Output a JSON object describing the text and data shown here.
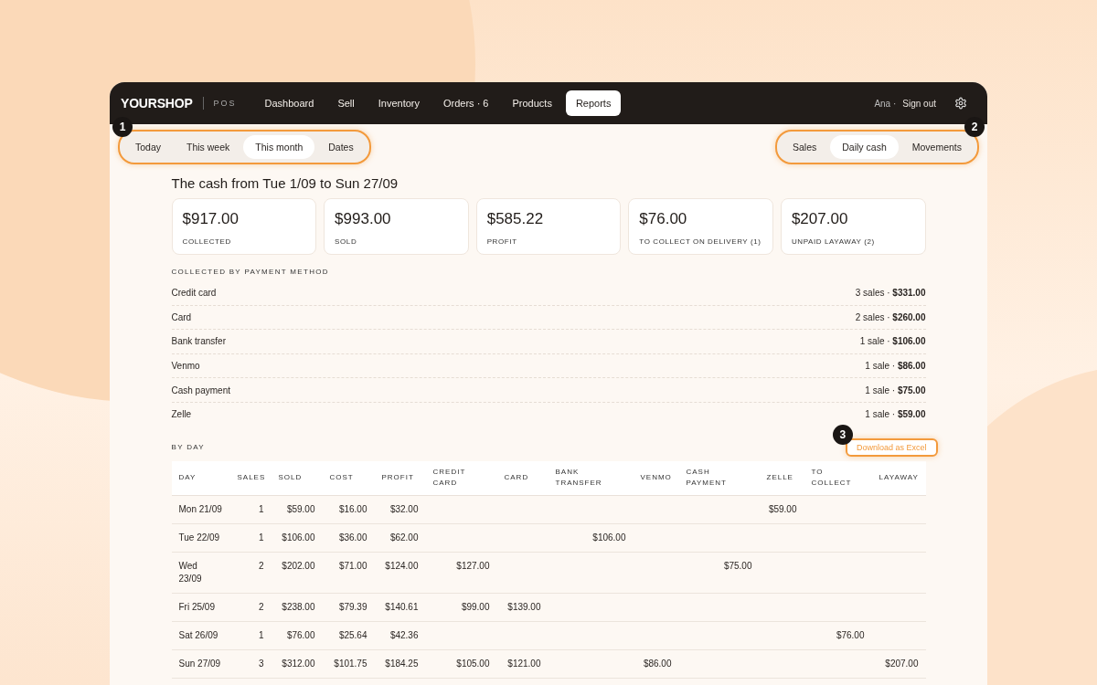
{
  "brand": {
    "name": "YOURSHOP",
    "suffix": "POS"
  },
  "nav": [
    {
      "label": "Dashboard",
      "selected": false
    },
    {
      "label": "Sell",
      "selected": false
    },
    {
      "label": "Inventory",
      "selected": false
    },
    {
      "label": "Orders · 6",
      "selected": false
    },
    {
      "label": "Products",
      "selected": false
    },
    {
      "label": "Reports",
      "selected": true
    }
  ],
  "user": {
    "name": "Ana ·",
    "action": "Sign out"
  },
  "period_tabs": {
    "marker": "1",
    "items": [
      {
        "label": "Today",
        "selected": false
      },
      {
        "label": "This week",
        "selected": false
      },
      {
        "label": "This month",
        "selected": true
      },
      {
        "label": "Dates",
        "selected": false
      }
    ]
  },
  "view_tabs": {
    "marker": "2",
    "items": [
      {
        "label": "Sales",
        "selected": false
      },
      {
        "label": "Daily cash",
        "selected": true
      },
      {
        "label": "Movements",
        "selected": false
      }
    ]
  },
  "title": "The cash from Tue 1/09 to Sun 27/09",
  "stats": [
    {
      "value": "$917.00",
      "label": "COLLECTED"
    },
    {
      "value": "$993.00",
      "label": "SOLD"
    },
    {
      "value": "$585.22",
      "label": "PROFIT"
    },
    {
      "value": "$76.00",
      "label": "TO COLLECT ON DELIVERY (1)"
    },
    {
      "value": "$207.00",
      "label": "UNPAID LAYAWAY (2)"
    }
  ],
  "payment_methods": {
    "heading": "COLLECTED BY PAYMENT METHOD",
    "rows": [
      {
        "name": "Credit card",
        "count": "3 sales ·",
        "amount": "$331.00"
      },
      {
        "name": "Card",
        "count": "2 sales ·",
        "amount": "$260.00"
      },
      {
        "name": "Bank transfer",
        "count": "1 sale ·",
        "amount": "$106.00"
      },
      {
        "name": "Venmo",
        "count": "1 sale ·",
        "amount": "$86.00"
      },
      {
        "name": "Cash payment",
        "count": "1 sale ·",
        "amount": "$75.00"
      },
      {
        "name": "Zelle",
        "count": "1 sale ·",
        "amount": "$59.00"
      }
    ]
  },
  "by_day": {
    "heading": "BY DAY",
    "download": {
      "label": "Download as Excel",
      "marker": "3"
    },
    "columns": [
      "DAY",
      "SALES",
      "SOLD",
      "COST",
      "PROFIT",
      "CREDIT CARD",
      "CARD",
      "BANK TRANSFER",
      "VENMO",
      "CASH PAYMENT",
      "ZELLE",
      "TO COLLECT",
      "LAYAWAY"
    ],
    "rows": [
      [
        "Mon 21/09",
        "1",
        "$59.00",
        "$16.00",
        "$32.00",
        null,
        null,
        null,
        null,
        null,
        "$59.00",
        null,
        null
      ],
      [
        "Tue 22/09",
        "1",
        "$106.00",
        "$36.00",
        "$62.00",
        null,
        null,
        "$106.00",
        null,
        null,
        null,
        null,
        null
      ],
      [
        "Wed 23/09",
        "2",
        "$202.00",
        "$71.00",
        "$124.00",
        "$127.00",
        null,
        null,
        null,
        "$75.00",
        null,
        null,
        null
      ],
      [
        "Fri 25/09",
        "2",
        "$238.00",
        "$79.39",
        "$140.61",
        "$99.00",
        "$139.00",
        null,
        null,
        null,
        null,
        null,
        null
      ],
      [
        "Sat 26/09",
        "1",
        "$76.00",
        "$25.64",
        "$42.36",
        null,
        null,
        null,
        null,
        null,
        null,
        "$76.00",
        null
      ],
      [
        "Sun 27/09",
        "3",
        "$312.00",
        "$101.75",
        "$184.25",
        "$105.00",
        "$121.00",
        null,
        "$86.00",
        null,
        null,
        null,
        "$207.00"
      ]
    ]
  }
}
